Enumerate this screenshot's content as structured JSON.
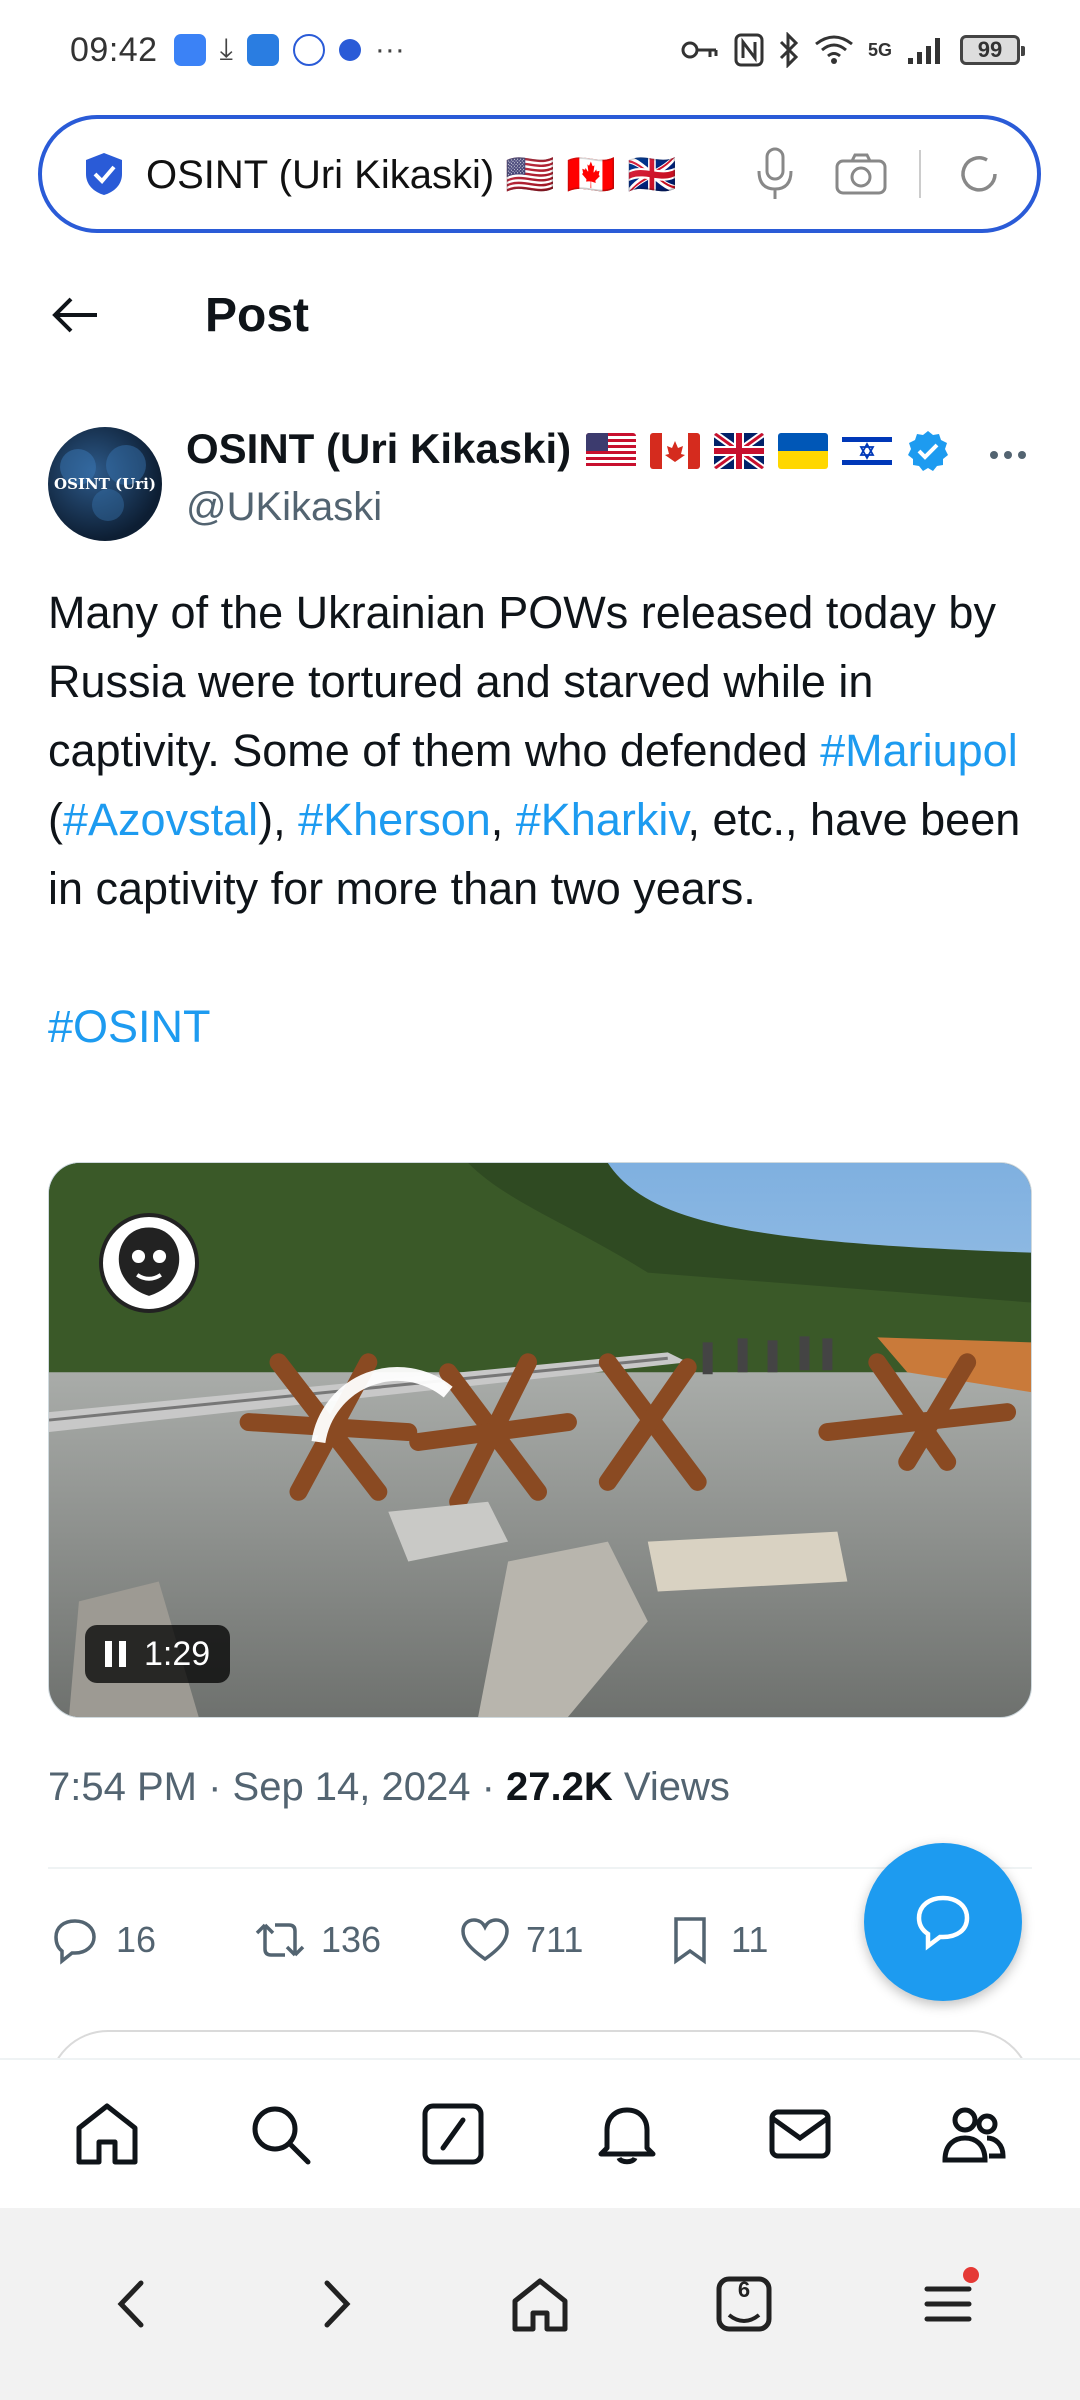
{
  "status_bar": {
    "time": "09:42",
    "network": "5G",
    "battery": "99",
    "more": "···"
  },
  "browser": {
    "address_text": "OSINT (Uri Kikaski) 🇺🇸 🇨🇦 🇬🇧",
    "tab_count": "6"
  },
  "header": {
    "title": "Post"
  },
  "post": {
    "author_name": "OSINT (Uri Kikaski)",
    "author_handle": "@UKikaski",
    "avatar_text": "OSINT (Uri)",
    "body_part1": "Many of the Ukrainian POWs released today by Russia were tortured and starved while in captivity. Some of them who defended ",
    "tag_mariupol": "#Mariupol",
    "paren_open": " (",
    "tag_azovstal": "#Azovstal",
    "paren_close": "), ",
    "tag_kherson": "#Kherson",
    "comma": ", ",
    "tag_kharkiv": "#Kharkiv",
    "body_part2": ", etc., have been in captivity for more than two years.",
    "tag_osint": "#OSINT",
    "video_duration": "1:29",
    "timestamp": "7:54 PM · Sep 14, 2024 · ",
    "views_count": "27.2K",
    "views_label": " Views"
  },
  "actions": {
    "replies": "16",
    "reposts": "136",
    "likes": "711",
    "bookmarks": "11"
  },
  "colors": {
    "accent": "#1d9bf0",
    "address_border": "#2a5bd7",
    "muted_text": "#536471"
  }
}
